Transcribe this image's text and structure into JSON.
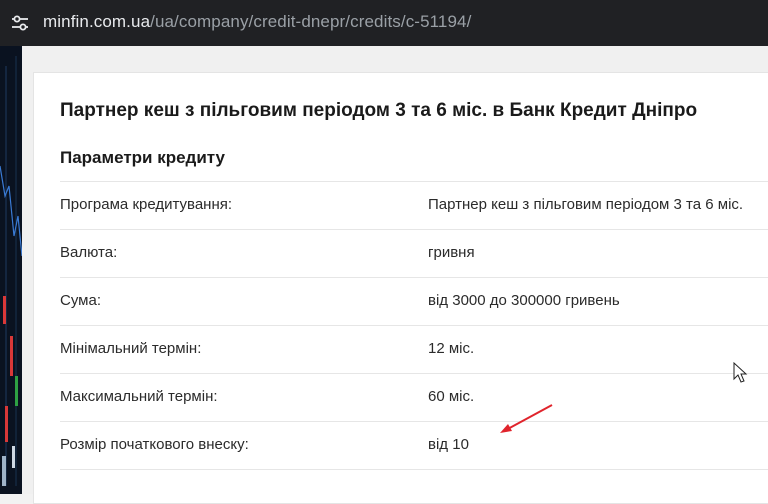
{
  "browser": {
    "url_host": "minfin.com.ua",
    "url_path": "/ua/company/credit-dnepr/credits/c-51194/",
    "site_info_icon": "tune-icon"
  },
  "card": {
    "title": "Партнер кеш з пільговим періодом 3 та 6 міс. в Банк Кредит Дніпро",
    "section_title": "Параметри кредиту",
    "rows": [
      {
        "label": "Програма кредитування:",
        "value": "Партнер кеш з пільговим періодом 3 та 6 міс."
      },
      {
        "label": "Валюта:",
        "value": "гривня"
      },
      {
        "label": "Сума:",
        "value": "від 3000 до 300000 гривень"
      },
      {
        "label": "Мінімальний термін:",
        "value": "12 міс."
      },
      {
        "label": "Максимальний термін:",
        "value": "60 міс."
      },
      {
        "label": "Розмір початкового внеску:",
        "value": "від 10"
      }
    ]
  },
  "annotation": {
    "arrow_color": "#e0242c",
    "icon": "red-arrow-icon"
  },
  "colors": {
    "browser_bar": "#202124",
    "url_text": "#e8eaed",
    "url_path": "#9aa0a6"
  }
}
